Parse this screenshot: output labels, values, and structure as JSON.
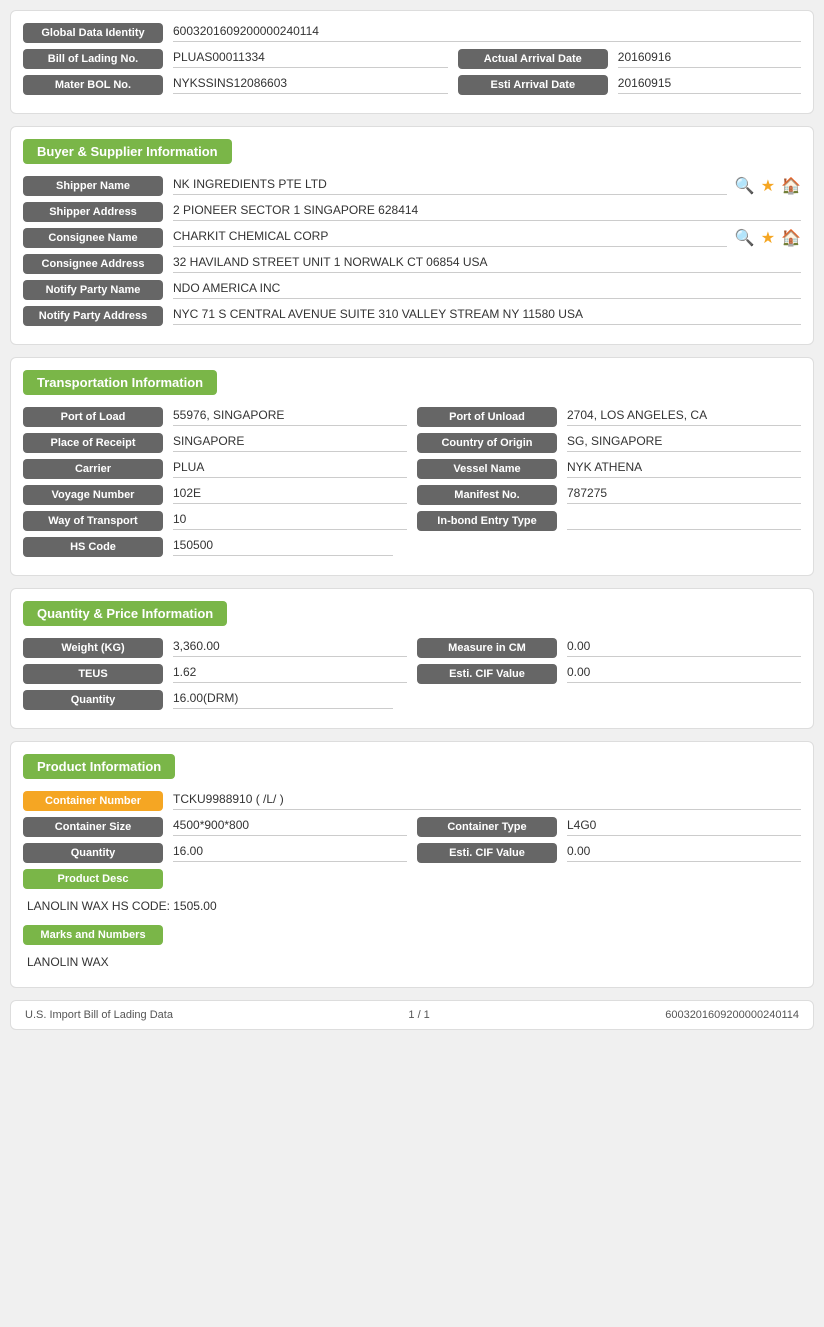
{
  "top": {
    "global_label": "Global Data Identity",
    "global_value": "6003201609200000240114",
    "bol_label": "Bill of Lading No.",
    "bol_value": "PLUAS00011334",
    "actual_arrival_label": "Actual Arrival Date",
    "actual_arrival_value": "20160916",
    "mater_label": "Mater BOL No.",
    "mater_value": "NYKSSINS12086603",
    "esti_arrival_label": "Esti Arrival Date",
    "esti_arrival_value": "20160915"
  },
  "buyer_supplier": {
    "section_title": "Buyer & Supplier Information",
    "shipper_name_label": "Shipper Name",
    "shipper_name_value": "NK INGREDIENTS PTE LTD",
    "shipper_address_label": "Shipper Address",
    "shipper_address_value": "2 PIONEER SECTOR 1 SINGAPORE 628414",
    "consignee_name_label": "Consignee Name",
    "consignee_name_value": "CHARKIT CHEMICAL CORP",
    "consignee_address_label": "Consignee Address",
    "consignee_address_value": "32 HAVILAND STREET UNIT 1 NORWALK CT 06854 USA",
    "notify_party_name_label": "Notify Party Name",
    "notify_party_name_value": "NDO AMERICA INC",
    "notify_party_address_label": "Notify Party Address",
    "notify_party_address_value": "NYC 71 S CENTRAL AVENUE SUITE 310 VALLEY STREAM NY 11580 USA"
  },
  "transportation": {
    "section_title": "Transportation Information",
    "port_load_label": "Port of Load",
    "port_load_value": "55976, SINGAPORE",
    "port_unload_label": "Port of Unload",
    "port_unload_value": "2704, LOS ANGELES, CA",
    "place_receipt_label": "Place of Receipt",
    "place_receipt_value": "SINGAPORE",
    "country_origin_label": "Country of Origin",
    "country_origin_value": "SG, SINGAPORE",
    "carrier_label": "Carrier",
    "carrier_value": "PLUA",
    "vessel_name_label": "Vessel Name",
    "vessel_name_value": "NYK ATHENA",
    "voyage_label": "Voyage Number",
    "voyage_value": "102E",
    "manifest_label": "Manifest No.",
    "manifest_value": "787275",
    "way_transport_label": "Way of Transport",
    "way_transport_value": "10",
    "inbond_label": "In-bond Entry Type",
    "inbond_value": "",
    "hs_code_label": "HS Code",
    "hs_code_value": "150500"
  },
  "quantity_price": {
    "section_title": "Quantity & Price Information",
    "weight_label": "Weight (KG)",
    "weight_value": "3,360.00",
    "measure_label": "Measure in CM",
    "measure_value": "0.00",
    "teus_label": "TEUS",
    "teus_value": "1.62",
    "esti_cif_label": "Esti. CIF Value",
    "esti_cif_value": "0.00",
    "quantity_label": "Quantity",
    "quantity_value": "16.00(DRM)"
  },
  "product": {
    "section_title": "Product Information",
    "container_number_label": "Container Number",
    "container_number_value": "TCKU9988910 ( /L/ )",
    "container_size_label": "Container Size",
    "container_size_value": "4500*900*800",
    "container_type_label": "Container Type",
    "container_type_value": "L4G0",
    "quantity_label": "Quantity",
    "quantity_value": "16.00",
    "esti_cif_label": "Esti. CIF Value",
    "esti_cif_value": "0.00",
    "product_desc_label": "Product Desc",
    "product_desc_value": "LANOLIN WAX HS CODE: 1505.00",
    "marks_label": "Marks and Numbers",
    "marks_value": "LANOLIN WAX"
  },
  "footer": {
    "left": "U.S. Import Bill of Lading Data",
    "center": "1 / 1",
    "right": "6003201609200000240114"
  }
}
